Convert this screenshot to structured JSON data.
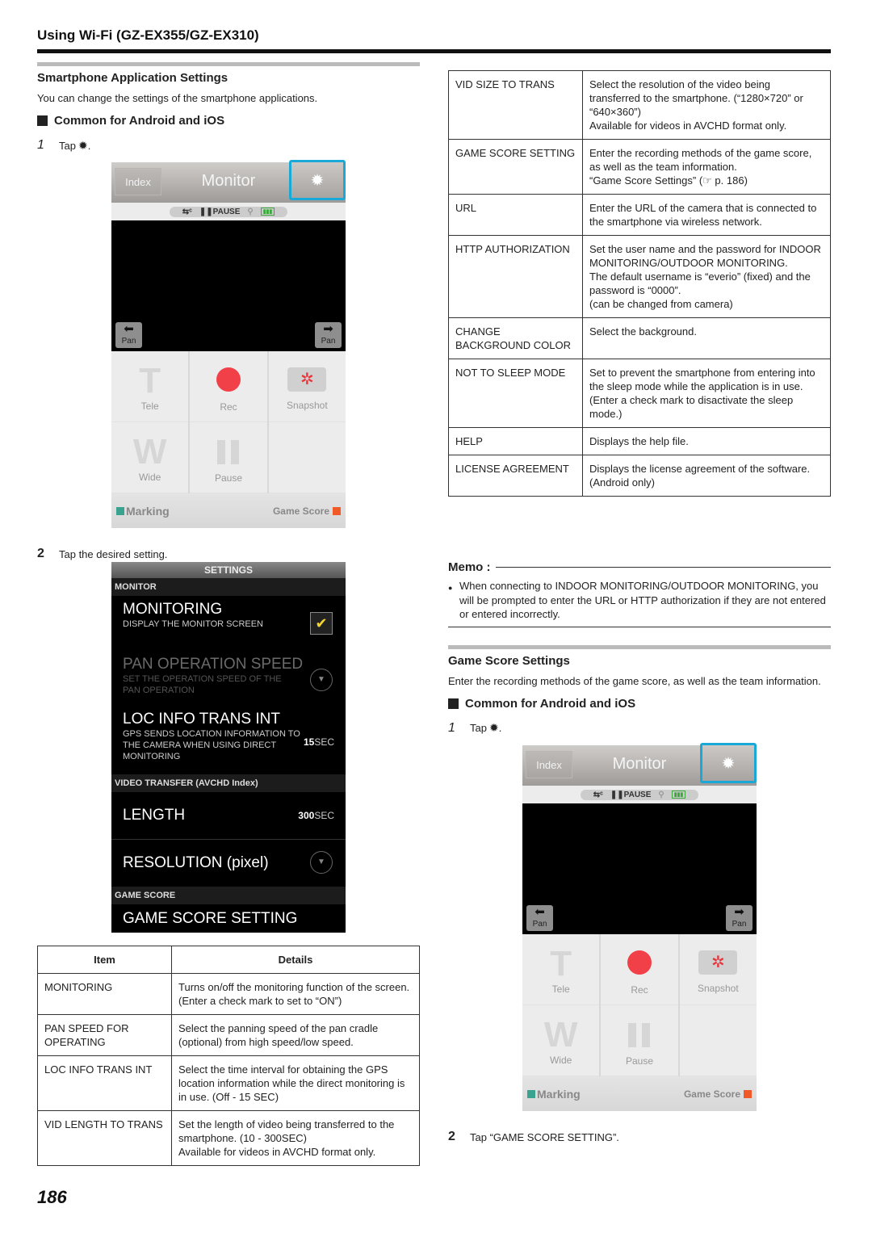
{
  "header": {
    "title": "Using Wi-Fi (GZ-EX355/GZ-EX310)"
  },
  "left": {
    "section_title": "Smartphone Application Settings",
    "section_desc": "You can change the settings of the smartphone applications.",
    "subhead": "Common for Android and iOS",
    "step1": {
      "num": "1",
      "text": "Tap",
      "icon": "gear-icon",
      "glyph": "✹",
      "suffix": "."
    },
    "step2": {
      "num": "2",
      "text": "Tap the desired setting."
    }
  },
  "phone": {
    "index_label": "Index",
    "title": "Monitor",
    "gear_glyph": "✹",
    "status": {
      "arrows": "⇆ᶜ",
      "pause": "❚❚PAUSE",
      "link": "⚲",
      "battery": "▮▮▮"
    },
    "pan_left": {
      "arrow": "⬅",
      "label": "Pan"
    },
    "pan_right": {
      "arrow": "➡",
      "label": "Pan"
    },
    "buttons": {
      "tele_glyph": "T",
      "tele": "Tele",
      "rec": "Rec",
      "snapshot_glyph": "✲",
      "snapshot": "Snapshot",
      "wide_glyph": "W",
      "wide": "Wide",
      "pause": "Pause"
    },
    "marking": "Marking",
    "game_score": "Game Score"
  },
  "settings_screen": {
    "title": "SETTINGS",
    "cat_monitor": "MONITOR",
    "monitoring": {
      "title": "MONITORING",
      "sub": "DISPLAY THE MONITOR SCREEN",
      "checked": true,
      "check_glyph": "✔"
    },
    "pan_speed": {
      "title": "PAN OPERATION SPEED",
      "sub": "SET THE OPERATION SPEED OF THE PAN OPERATION",
      "dd_glyph": "▼"
    },
    "loc_info": {
      "title": "LOC INFO TRANS INT",
      "sub": "GPS SENDS LOCATION INFORMATION TO THE CAMERA WHEN USING DIRECT MONITORING",
      "value_num": "15",
      "value_unit": "SEC"
    },
    "cat_video": "VIDEO TRANSFER (AVCHD Index)",
    "length": {
      "title": "LENGTH",
      "value_num": "300",
      "value_unit": "SEC"
    },
    "resolution": {
      "title": "RESOLUTION (pixel)",
      "dd_glyph": "▼"
    },
    "cat_game": "GAME SCORE",
    "game_score_setting": {
      "title": "GAME SCORE SETTING"
    }
  },
  "table_left": {
    "headers": [
      "Item",
      "Details"
    ],
    "rows": [
      {
        "item": [
          "MONITORING"
        ],
        "details": [
          "Turns on/off the monitoring function of the screen. (Enter a check mark to set to “ON”)"
        ]
      },
      {
        "item": [
          "PAN SPEED FOR OPERATING"
        ],
        "details": [
          "Select the panning speed of the pan cradle (optional) from high speed/low speed."
        ]
      },
      {
        "item": [
          "LOC INFO TRANS INT"
        ],
        "details": [
          "Select the time interval for obtaining the GPS location information while the direct monitoring is in use. (Off - 15 SEC)"
        ]
      },
      {
        "item": [
          "VID LENGTH TO TRANS"
        ],
        "details": [
          "Set the length of video being transferred to the smartphone. (10 - 300SEC)",
          "Available for videos in AVCHD format only."
        ]
      }
    ]
  },
  "table_right": {
    "rows": [
      {
        "item": [
          "VID SIZE TO TRANS"
        ],
        "details": [
          "Select the resolution of the video being transferred to the smartphone. (“1280×720” or “640×360”)",
          "Available for videos in AVCHD format only."
        ]
      },
      {
        "item": [
          "GAME SCORE SETTING"
        ],
        "details": [
          "Enter the recording methods of the game score, as well as the team information.",
          "“Game Score Settings” (☞ p. 186)"
        ]
      },
      {
        "item": [
          "URL"
        ],
        "details": [
          "Enter the URL of the camera that is connected to the smartphone via wireless network."
        ]
      },
      {
        "item": [
          "HTTP AUTHORIZATION"
        ],
        "details": [
          "Set the user name and the password for INDOOR MONITORING/OUTDOOR MONITORING.",
          "The default username is “everio” (fixed) and the password is “0000”.",
          "(can be changed from camera)"
        ]
      },
      {
        "item": [
          "CHANGE BACKGROUND COLOR"
        ],
        "details": [
          "Select the background."
        ]
      },
      {
        "item": [
          "NOT TO SLEEP MODE"
        ],
        "details": [
          "Set to prevent the smartphone from entering into the sleep mode while the application is in use.",
          "(Enter a check mark to disactivate the sleep mode.)"
        ]
      },
      {
        "item": [
          "HELP"
        ],
        "details": [
          "Displays the help file."
        ]
      },
      {
        "item": [
          "LICENSE AGREEMENT"
        ],
        "details": [
          "Displays the license agreement of the software. (Android only)"
        ]
      }
    ]
  },
  "memo": {
    "label": "Memo :",
    "bullet": "●",
    "text": "When connecting to INDOOR MONITORING/OUTDOOR MONITORING, you will be prompted to enter the URL or HTTP authorization if they are not entered or entered incorrectly."
  },
  "right": {
    "section_title": "Game Score Settings",
    "section_desc": "Enter the recording methods of the game score, as well as the team information.",
    "subhead": "Common for Android and iOS",
    "step1": {
      "num": "1",
      "text": "Tap",
      "glyph": "✹",
      "suffix": "."
    },
    "step2": {
      "num": "2",
      "text": "Tap “GAME SCORE SETTING”."
    }
  },
  "page_number": "186",
  "colors": {
    "highlight": "#1aa9d6",
    "rec": "#f24048",
    "marking": "#3aa38f",
    "game_score": "#ef5a28",
    "check": "#f4d42e"
  }
}
